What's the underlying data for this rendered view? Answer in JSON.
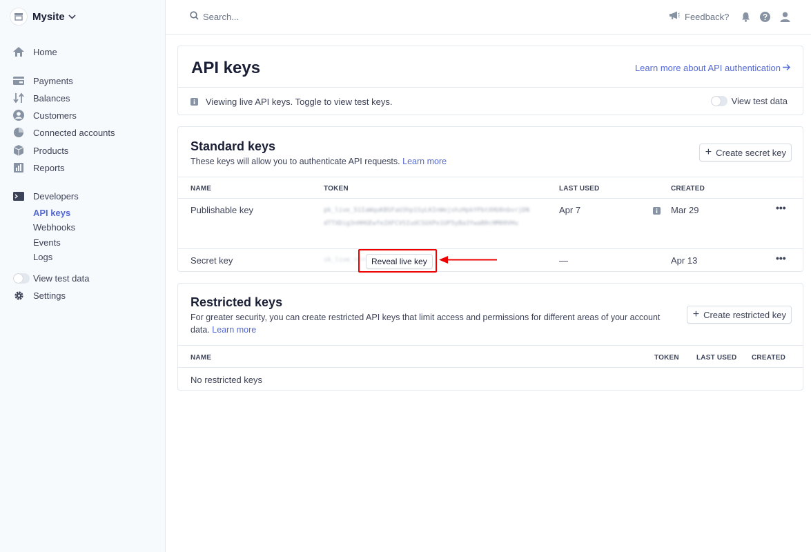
{
  "account": {
    "name": "Mysite"
  },
  "sidebar": {
    "home": "Home",
    "payments": "Payments",
    "balances": "Balances",
    "customers": "Customers",
    "connected_accounts": "Connected accounts",
    "products": "Products",
    "reports": "Reports",
    "developers": "Developers",
    "developers_sub": [
      "API keys",
      "Webhooks",
      "Events",
      "Logs"
    ],
    "view_test_data": "View test data",
    "settings": "Settings"
  },
  "topbar": {
    "search_placeholder": "Search...",
    "feedback": "Feedback?"
  },
  "header": {
    "title": "API keys",
    "learn_link": "Learn more about API authentication",
    "notice": "Viewing live API keys. Toggle to view test keys.",
    "toggle_label": "View test data"
  },
  "standard": {
    "title": "Standard keys",
    "description": "These keys will allow you to authenticate API requests.",
    "learn_more": "Learn more",
    "create_button": "Create secret key",
    "columns": [
      "NAME",
      "TOKEN",
      "LAST USED",
      "CREATED"
    ],
    "rows": [
      {
        "name": "Publishable key",
        "token": "pk_live_51IaWquKBSFaU3hp1SyLKInWejshzHpkYPbtXHU0nbvrjDNdTTXDig3nHHGEwfeZAFCVSIudCSUXPo1UP5yBa3YwaB0cHM00VHu",
        "last_used": "Apr 7",
        "created": "Mar 29"
      },
      {
        "name": "Secret key",
        "token_masked": "sk_live_••••••••••••••••••••",
        "reveal_button": "Reveal live key",
        "last_used": "—",
        "created": "Apr 13"
      }
    ]
  },
  "restricted": {
    "title": "Restricted keys",
    "description": "For greater security, you can create restricted API keys that limit access and permissions for different areas of your account data.",
    "learn_more": "Learn more",
    "create_button": "Create restricted key",
    "columns": [
      "NAME",
      "TOKEN",
      "LAST USED",
      "CREATED"
    ],
    "empty": "No restricted keys"
  },
  "colors": {
    "accent": "#5469d4",
    "highlight": "#e00000",
    "text": "#3c4257",
    "heading": "#1a1f36",
    "border": "#e3e8ee"
  }
}
